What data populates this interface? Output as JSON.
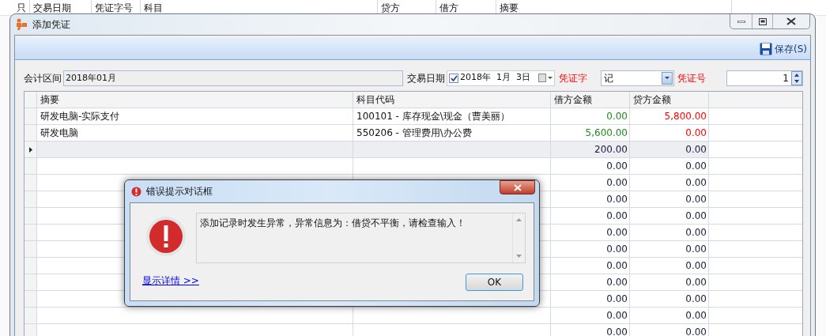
{
  "background_list": {
    "columns": [
      "只",
      "交易日期",
      "凭证字号",
      "科目",
      "贷方",
      "借方",
      "摘要"
    ]
  },
  "window": {
    "title": "添加凭证",
    "toolbar": {
      "save_label": "保存(S)"
    },
    "form": {
      "period_label": "会计区间",
      "period_value": "2018年01月",
      "date_label": "交易日期",
      "date_checked": true,
      "date_value": "2018年  1月  3日",
      "voucher_type_label": "凭证字",
      "voucher_type_value": "记",
      "voucher_no_label": "凭证号",
      "voucher_no_value": "1"
    },
    "grid": {
      "columns": [
        "摘要",
        "科目代码",
        "借方金额",
        "贷方金额"
      ],
      "rows": [
        {
          "kind": "entry",
          "selected": false,
          "summary": "研发电脑-实际支付",
          "account": "100101 - 库存现金\\现金（曹美丽）",
          "debit": "0.00",
          "credit": "5,800.00"
        },
        {
          "kind": "entry",
          "selected": false,
          "summary": "研发电脑",
          "account": "550206 - 管理费用\\办公费",
          "debit": "5,600.00",
          "credit": "0.00"
        },
        {
          "kind": "blank",
          "selected": true,
          "debit": "200.00",
          "credit": "0.00"
        },
        {
          "kind": "blank",
          "selected": false,
          "debit": "0.00",
          "credit": "0.00"
        },
        {
          "kind": "blank",
          "selected": false,
          "debit": "0.00",
          "credit": "0.00"
        },
        {
          "kind": "blank",
          "selected": false,
          "debit": "0.00",
          "credit": "0.00"
        },
        {
          "kind": "blank",
          "selected": false,
          "debit": "0.00",
          "credit": "0.00"
        },
        {
          "kind": "blank",
          "selected": false,
          "debit": "0.00",
          "credit": "0.00"
        },
        {
          "kind": "blank",
          "selected": false,
          "debit": "0.00",
          "credit": "0.00"
        },
        {
          "kind": "blank",
          "selected": false,
          "debit": "0.00",
          "credit": "0.00"
        },
        {
          "kind": "blank",
          "selected": false,
          "debit": "0.00",
          "credit": "0.00"
        },
        {
          "kind": "blank",
          "selected": false,
          "debit": "0.00",
          "credit": "0.00"
        },
        {
          "kind": "blank",
          "selected": false,
          "debit": "0.00",
          "credit": "0.00"
        },
        {
          "kind": "blank",
          "selected": false,
          "debit": "0.00",
          "credit": "0.00"
        }
      ]
    }
  },
  "dialog": {
    "title": "错误提示对话框",
    "message": "添加记录时发生异常，异常信息为：借贷不平衡，请检查输入！",
    "details_link": "显示详情 >>",
    "ok_label": "OK"
  }
}
